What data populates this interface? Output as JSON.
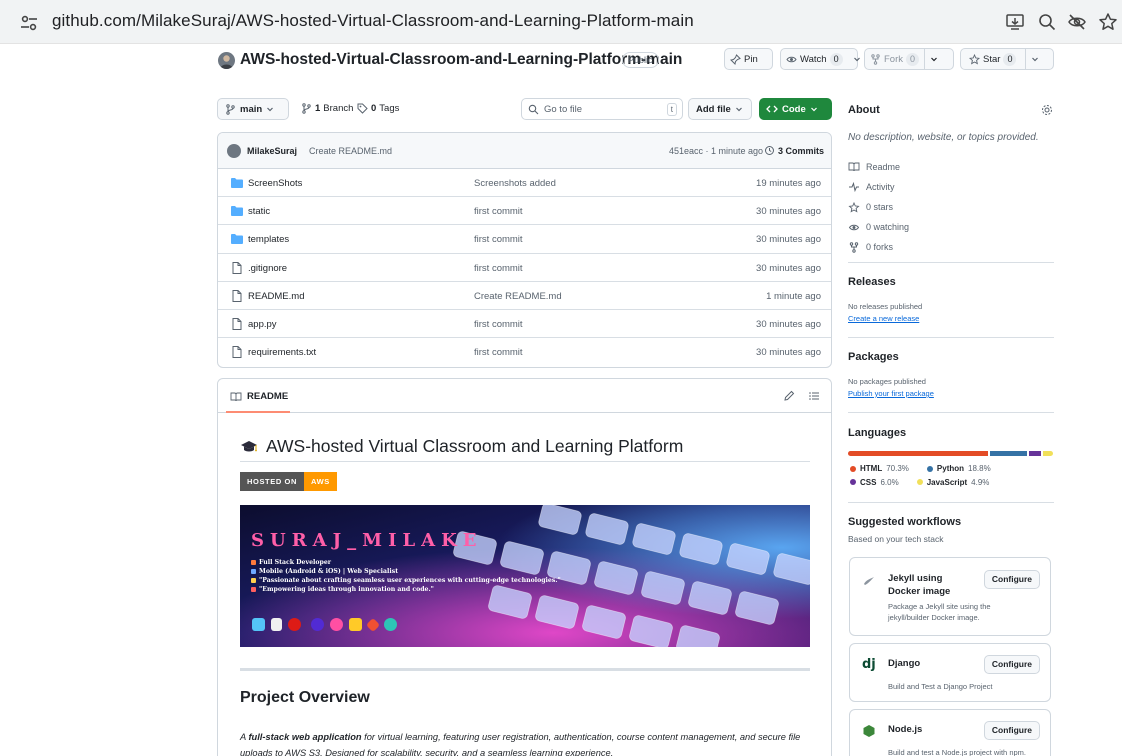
{
  "browser": {
    "url": "github.com/MilakeSuraj/AWS-hosted-Virtual-Classroom-and-Learning-Platform-main"
  },
  "repo": {
    "name": "AWS-hosted-Virtual-Classroom-and-Learning-Platform-main",
    "visibility": "Public",
    "pin_label": "Pin",
    "watch_label": "Watch",
    "watch_count": "0",
    "fork_label": "Fork",
    "fork_count": "0",
    "star_label": "Star",
    "star_count": "0"
  },
  "toolbar": {
    "branch": "main",
    "branches_count": "1",
    "branches_label": "Branch",
    "tags_count": "0",
    "tags_label": "Tags",
    "search_placeholder": "Go to file",
    "search_key": "t",
    "add_file_label": "Add file",
    "code_label": "Code"
  },
  "latest_commit": {
    "author": "MilakeSuraj",
    "message": "Create README.md",
    "hash_time": "451eacc · 1 minute ago",
    "commits": "3 Commits"
  },
  "files": [
    {
      "name": "ScreenShots",
      "type": "folder",
      "message": "Screenshots added",
      "age": "19 minutes ago"
    },
    {
      "name": "static",
      "type": "folder",
      "message": "first commit",
      "age": "30 minutes ago"
    },
    {
      "name": "templates",
      "type": "folder",
      "message": "first commit",
      "age": "30 minutes ago"
    },
    {
      "name": ".gitignore",
      "type": "file",
      "message": "first commit",
      "age": "30 minutes ago"
    },
    {
      "name": "README.md",
      "type": "file",
      "message": "Create README.md",
      "age": "1 minute ago"
    },
    {
      "name": "app.py",
      "type": "file",
      "message": "first commit",
      "age": "30 minutes ago"
    },
    {
      "name": "requirements.txt",
      "type": "file",
      "message": "first commit",
      "age": "30 minutes ago"
    }
  ],
  "readme": {
    "tab_label": "README",
    "title": "AWS-hosted Virtual Classroom and Learning Platform",
    "badge_left": "HOSTED ON",
    "badge_right": "AWS",
    "banner": {
      "name": "SURAJ_MILAKE",
      "lines": [
        "Full Stack Developer",
        "Mobile (Android & iOS) | Web Specialist",
        "\"Passionate about crafting seamless user experiences with cutting-edge technologies.\"",
        "\"Empowering ideas through innovation and code.\""
      ]
    },
    "section_title": "Project Overview",
    "para_bold": "full-stack web application",
    "para_prefix": "A ",
    "para_rest": " for virtual learning, featuring user registration, authentication, course content management, and secure file uploads to AWS S3. Designed for scalability, security, and a seamless learning experience."
  },
  "sidebar": {
    "about_title": "About",
    "about_desc": "No description, website, or topics provided.",
    "about_items": [
      {
        "icon": "book-icon",
        "label": "Readme"
      },
      {
        "icon": "activity-icon",
        "label": "Activity"
      },
      {
        "icon": "star-icon",
        "label": "0 stars"
      },
      {
        "icon": "eye-icon",
        "label": "0 watching"
      },
      {
        "icon": "fork-icon",
        "label": "0 forks"
      }
    ],
    "releases_title": "Releases",
    "releases_none": "No releases published",
    "releases_link": "Create a new release",
    "packages_title": "Packages",
    "packages_none": "No packages published",
    "packages_link": "Publish your first package",
    "languages_title": "Languages",
    "languages": [
      {
        "name": "HTML",
        "percent": "70.3%",
        "value": 70.3,
        "color": "#e34c26"
      },
      {
        "name": "Python",
        "percent": "18.8%",
        "value": 18.8,
        "color": "#3572a5"
      },
      {
        "name": "CSS",
        "percent": "6.0%",
        "value": 6.0,
        "color": "#663399"
      },
      {
        "name": "JavaScript",
        "percent": "4.9%",
        "value": 4.9,
        "color": "#f1e05a"
      }
    ],
    "workflows_title": "Suggested workflows",
    "workflows_subtitle": "Based on your tech stack",
    "workflows": [
      {
        "title": "Jekyll using Docker image",
        "desc": "Package a Jekyll site using the jekyll/builder Docker image.",
        "button": "Configure"
      },
      {
        "title": "Django",
        "desc": "Build and Test a Django Project",
        "button": "Configure"
      },
      {
        "title": "Node.js",
        "desc": "Build and test a Node.js project with npm.",
        "button": "Configure"
      }
    ]
  }
}
